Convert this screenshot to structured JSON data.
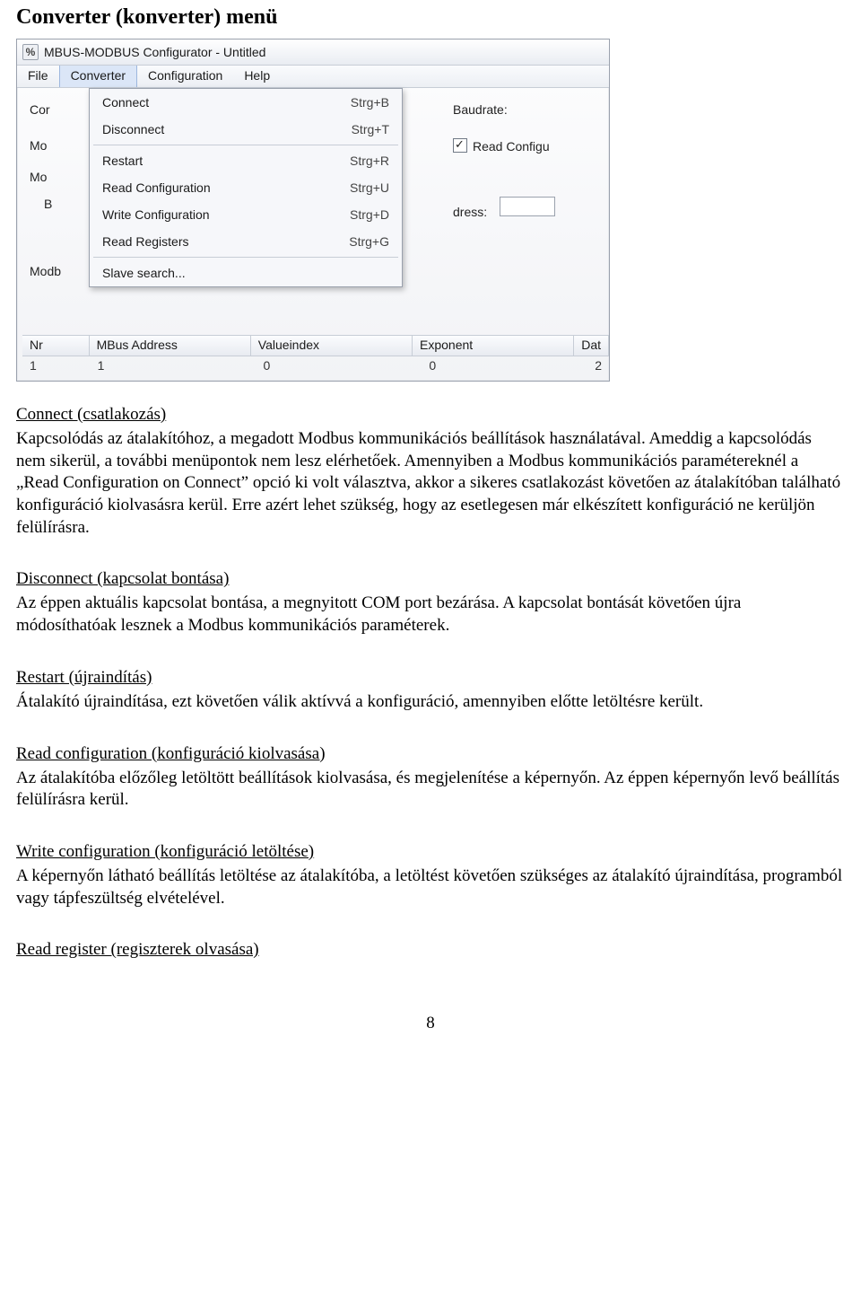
{
  "doc": {
    "title": "Converter (konverter) menü",
    "page_number": "8",
    "sections": [
      {
        "heading": "Connect (csatlakozás)",
        "body": "Kapcsolódás az átalakítóhoz, a megadott Modbus kommunikációs beállítások használatával. Ameddig a kapcsolódás nem sikerül, a további menüpontok nem lesz elérhetőek. Amennyiben a Modbus kommunikációs paramétereknél a „Read Configuration on Connect” opció ki volt választva, akkor a sikeres csatlakozást követően az átalakítóban található konfiguráció kiolvasásra kerül. Erre azért lehet szükség, hogy az esetlegesen már elkészített konfiguráció ne kerüljön felülírásra."
      },
      {
        "heading": "Disconnect (kapcsolat bontása)",
        "body": "Az éppen aktuális kapcsolat bontása, a megnyitott COM port bezárása. A kapcsolat bontását követően újra módosíthatóak lesznek a Modbus kommunikációs paraméterek."
      },
      {
        "heading": "Restart (újraindítás)",
        "body": "Átalakító újraindítása, ezt követően válik aktívvá a konfiguráció, amennyiben előtte letöltésre került."
      },
      {
        "heading": "Read configuration (konfiguráció kiolvasása)",
        "body": "Az átalakítóba előzőleg letöltött beállítások kiolvasása, és megjelenítése a képernyőn. Az éppen képernyőn levő beállítás felülírásra kerül."
      },
      {
        "heading": "Write configuration (konfiguráció letöltése)",
        "body": "A képernyőn látható beállítás letöltése az átalakítóba, a letöltést követően szükséges az átalakító újraindítása, programból vagy tápfeszültség elvételével."
      },
      {
        "heading": "Read register (regiszterek olvasása)",
        "body": ""
      }
    ]
  },
  "app": {
    "window_title": "MBUS-MODBUS Configurator - Untitled",
    "menubar": [
      "File",
      "Converter",
      "Configuration",
      "Help"
    ],
    "open_menu_index": 1,
    "dropdown": [
      {
        "label": "Connect",
        "shortcut": "Strg+B"
      },
      {
        "label": "Disconnect",
        "shortcut": "Strg+T"
      },
      {
        "sep": true
      },
      {
        "label": "Restart",
        "shortcut": "Strg+R"
      },
      {
        "label": "Read Configuration",
        "shortcut": "Strg+U"
      },
      {
        "label": "Write Configuration",
        "shortcut": "Strg+D"
      },
      {
        "label": "Read Registers",
        "shortcut": "Strg+G"
      },
      {
        "sep": true
      },
      {
        "label": "Slave search...",
        "shortcut": ""
      }
    ],
    "bg": {
      "left_labels": [
        "Cor",
        "Mo",
        "Mo",
        "B",
        "Modb"
      ],
      "baudrate_label": "Baudrate:",
      "read_config_label": "Read Configu",
      "dress_label": "dress:"
    },
    "table": {
      "headers": [
        "Nr",
        "MBus Address",
        "Valueindex",
        "Exponent",
        "Dat"
      ],
      "widths": [
        60,
        170,
        170,
        170,
        80
      ],
      "row0": [
        "1",
        "1",
        "0",
        "0",
        "2"
      ]
    }
  }
}
